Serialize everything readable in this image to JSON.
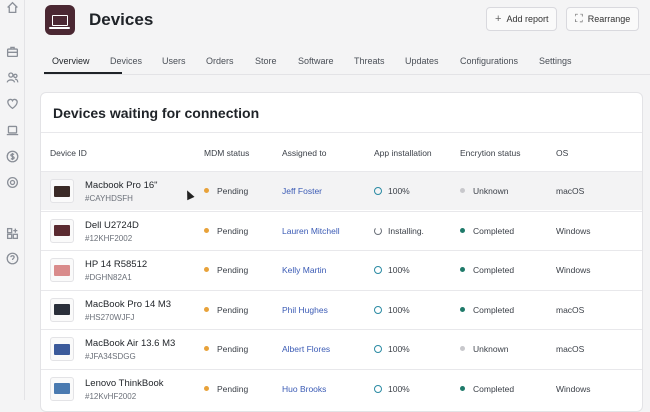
{
  "header": {
    "title": "Devices",
    "add_report": "Add report",
    "rearrange": "Rearrange"
  },
  "tabs": [
    {
      "label": "Overview",
      "active": true
    },
    {
      "label": "Devices"
    },
    {
      "label": "Users"
    },
    {
      "label": "Orders"
    },
    {
      "label": "Store"
    },
    {
      "label": "Software"
    },
    {
      "label": "Threats"
    },
    {
      "label": "Updates"
    },
    {
      "label": "Configurations"
    },
    {
      "label": "Settings"
    }
  ],
  "card": {
    "title": "Devices waiting for connection",
    "columns": [
      "Device ID",
      "MDM status",
      "Assigned to",
      "App installation",
      "Encrytion status",
      "OS"
    ],
    "rows": [
      {
        "name": "Macbook Pro 16\"",
        "id": "#CAYHDSFH",
        "mdm": "Pending",
        "assigned": "Jeff Foster",
        "app": "100%",
        "app_state": "done",
        "enc": "Unknown",
        "os": "macOS",
        "screen": "#3a2a26"
      },
      {
        "name": "Dell U2724D",
        "id": "#12KHF2002",
        "mdm": "Pending",
        "assigned": "Lauren Mitchell",
        "app": "Installing.",
        "app_state": "installing",
        "enc": "Completed",
        "os": "Windows",
        "screen": "#5a2a30"
      },
      {
        "name": "HP 14 R58512",
        "id": "#DGHN82A1",
        "mdm": "Pending",
        "assigned": "Kelly Martin",
        "app": "100%",
        "app_state": "done",
        "enc": "Completed",
        "os": "Windows",
        "screen": "#d98b8b"
      },
      {
        "name": "MacBook Pro 14 M3",
        "id": "#HS270WJFJ",
        "mdm": "Pending",
        "assigned": "Phil Hughes",
        "app": "100%",
        "app_state": "done",
        "enc": "Completed",
        "os": "macOS",
        "screen": "#2a2f3a"
      },
      {
        "name": "MacBook Air 13.6 M3",
        "id": "#JFA34SDGG",
        "mdm": "Pending",
        "assigned": "Albert Flores",
        "app": "100%",
        "app_state": "done",
        "enc": "Unknown",
        "os": "macOS",
        "screen": "#3b5a9a"
      },
      {
        "name": "Lenovo ThinkBook",
        "id": "#12KvHF2002",
        "mdm": "Pending",
        "assigned": "Huo Brooks",
        "app": "100%",
        "app_state": "done",
        "enc": "Completed",
        "os": "Windows",
        "screen": "#4a7ab0"
      }
    ]
  },
  "colors": {
    "pending": "#e8a23a",
    "completed": "#1f7a6a",
    "unknown": "#c8c8cc",
    "link": "#3b5bb5"
  },
  "sidebar_icons": [
    "home-icon",
    "briefcase-icon",
    "users-icon",
    "heart-icon",
    "laptop-icon",
    "dollar-icon",
    "gear-icon",
    "apps-icon",
    "help-icon"
  ]
}
